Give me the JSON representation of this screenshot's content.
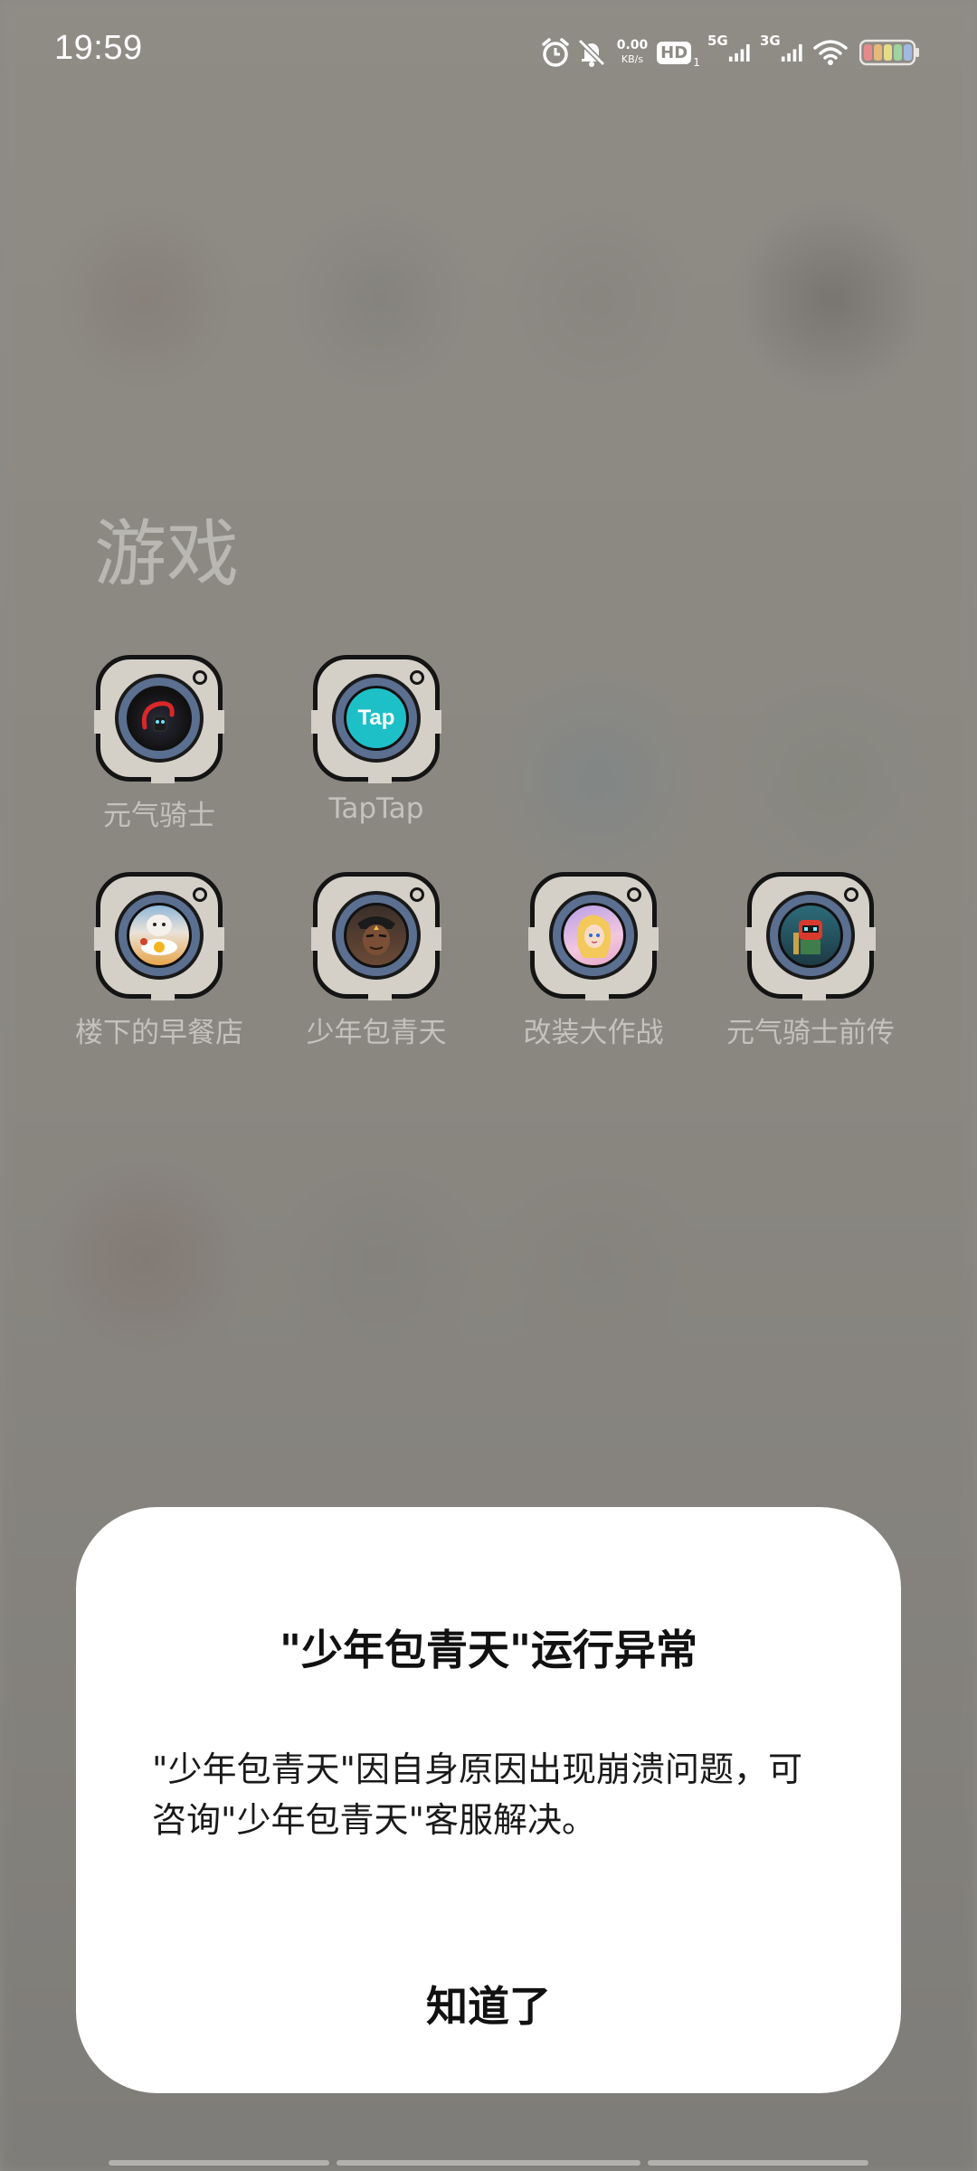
{
  "status_bar": {
    "time": "19:59",
    "net_speed_value": "0.00",
    "net_speed_unit": "KB/s",
    "hd_label": "HD",
    "hd_sub": "1",
    "signal1_label": "5G",
    "signal2_label": "3G",
    "icons": [
      "alarm-icon",
      "bell-off-icon",
      "hd-icon",
      "signal-5g-icon",
      "signal-3g-icon",
      "wifi-icon",
      "battery-icon"
    ]
  },
  "folder": {
    "title": "游戏",
    "apps": [
      {
        "label": "元气骑士",
        "icon": "soul-knight-icon"
      },
      {
        "label": "TapTap",
        "icon": "taptap-icon",
        "icon_text": "Tap"
      },
      {
        "label": "楼下的早餐店",
        "icon": "breakfast-shop-icon"
      },
      {
        "label": "少年包青天",
        "icon": "young-baoqingtian-icon"
      },
      {
        "label": "改装大作战",
        "icon": "gaizhuang-icon"
      },
      {
        "label": "元气骑士前传",
        "icon": "soul-knight-prequel-icon"
      }
    ]
  },
  "dialog": {
    "title": "\"少年包青天\"运行异常",
    "message": "\"少年包青天\"因自身原因出现崩溃问题，可咨询\"少年包青天\"客服解决。",
    "ok_label": "知道了"
  },
  "colors": {
    "taptap_teal": "#1ec0c8",
    "dialog_bg": "#ffffff",
    "scrim": "#8c8a85"
  }
}
